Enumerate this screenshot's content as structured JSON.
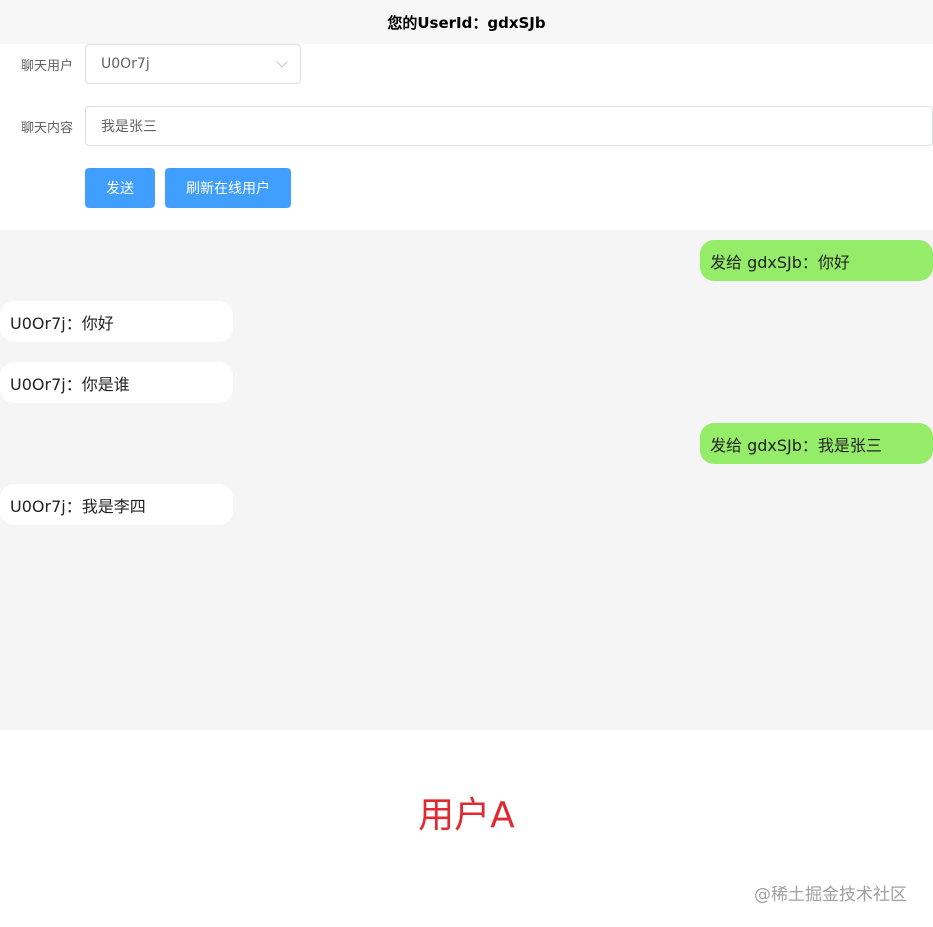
{
  "header": {
    "title": "您的UserId：gdxSJb"
  },
  "form": {
    "user_label": "聊天用户",
    "user_value": "U0Or7j",
    "content_label": "聊天内容",
    "content_value": "我是张三"
  },
  "buttons": {
    "send": "发送",
    "refresh": "刷新在线用户"
  },
  "messages": [
    {
      "direction": "sent",
      "text": "发给 gdxSJb：你好"
    },
    {
      "direction": "received",
      "text": "U0Or7j：你好"
    },
    {
      "direction": "received",
      "text": "U0Or7j：你是谁"
    },
    {
      "direction": "sent",
      "text": "发给 gdxSJb：我是张三"
    },
    {
      "direction": "received",
      "text": "U0Or7j：我是李四"
    }
  ],
  "caption": "用户A",
  "watermark": "@稀土掘金技术社区",
  "colors": {
    "primary": "#409eff",
    "sent_bubble": "#95ec69",
    "received_bubble": "#ffffff",
    "caption": "#e02a2f"
  }
}
